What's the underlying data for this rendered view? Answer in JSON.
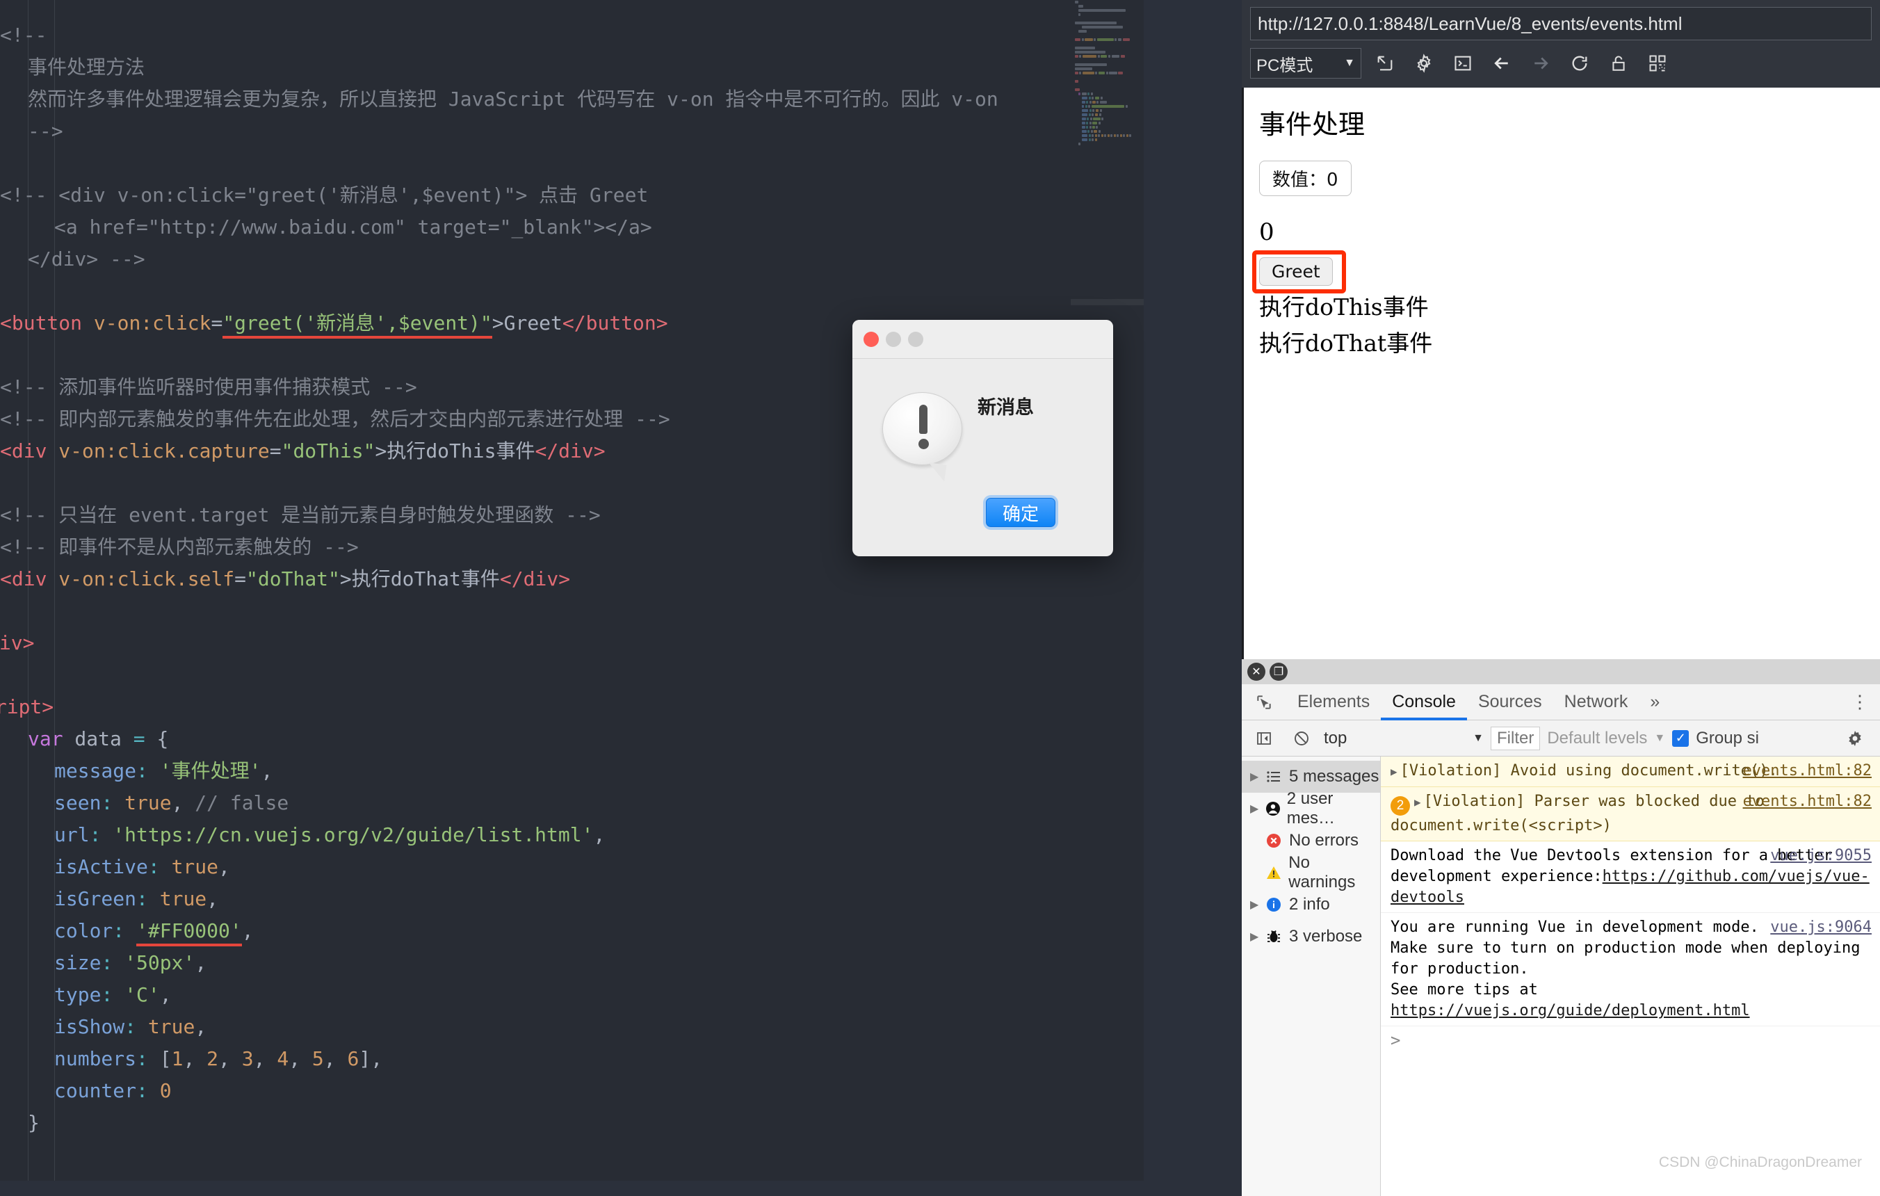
{
  "editor": {
    "lines": [
      {
        "indent": 0,
        "parts": [
          {
            "t": "<!--",
            "c": "cmt"
          }
        ]
      },
      {
        "indent": 1,
        "parts": [
          {
            "t": "事件处理方法",
            "c": "cmt"
          }
        ]
      },
      {
        "indent": 1,
        "parts": [
          {
            "t": "然而许多事件处理逻辑会更为复杂，所以直接把 JavaScript 代码写在 v-on 指令中是不可行的。因此 v-on",
            "c": "cmt"
          }
        ]
      },
      {
        "indent": 1,
        "parts": [
          {
            "t": "-->",
            "c": "cmt"
          }
        ]
      },
      {
        "indent": 0,
        "parts": []
      },
      {
        "indent": 0,
        "parts": [
          {
            "t": "<!-- <div v-on:click=\"greet('新消息',$event)\"> 点击 Greet",
            "c": "cmt"
          }
        ]
      },
      {
        "indent": 2,
        "parts": [
          {
            "t": "<a href=\"http://www.baidu.com\" target=\"_blank\"></a>",
            "c": "cmt"
          }
        ]
      },
      {
        "indent": 1,
        "parts": [
          {
            "t": "</div> -->",
            "c": "cmt"
          }
        ]
      },
      {
        "indent": 0,
        "parts": []
      },
      {
        "indent": 0,
        "parts": [
          {
            "t": "<button",
            "c": "tag"
          },
          {
            "t": " ",
            "c": "plain"
          },
          {
            "t": "v-on:click",
            "c": "attr"
          },
          {
            "t": "=",
            "c": "plain"
          },
          {
            "t": "\"greet('新消息',$event)\"",
            "c": "str",
            "underline": true
          },
          {
            "t": ">",
            "c": "plain"
          },
          {
            "t": "Greet",
            "c": "txt"
          },
          {
            "t": "</button>",
            "c": "tag"
          }
        ]
      },
      {
        "indent": 0,
        "parts": []
      },
      {
        "indent": 0,
        "parts": [
          {
            "t": "<!-- 添加事件监听器时使用事件捕获模式 -->",
            "c": "cmt"
          }
        ]
      },
      {
        "indent": 0,
        "parts": [
          {
            "t": "<!-- 即内部元素触发的事件先在此处理，然后才交由内部元素进行处理 -->",
            "c": "cmt"
          }
        ]
      },
      {
        "indent": 0,
        "parts": [
          {
            "t": "<div",
            "c": "tag"
          },
          {
            "t": " ",
            "c": "plain"
          },
          {
            "t": "v-on:click.capture",
            "c": "attr"
          },
          {
            "t": "=",
            "c": "plain"
          },
          {
            "t": "\"doThis\"",
            "c": "str"
          },
          {
            "t": ">",
            "c": "plain"
          },
          {
            "t": "执行doThis事件",
            "c": "txt"
          },
          {
            "t": "</div>",
            "c": "tag"
          }
        ]
      },
      {
        "indent": 0,
        "parts": []
      },
      {
        "indent": 0,
        "parts": [
          {
            "t": "<!-- 只当在 event.target 是当前元素自身时触发处理函数 -->",
            "c": "cmt"
          }
        ]
      },
      {
        "indent": 0,
        "parts": [
          {
            "t": "<!-- 即事件不是从内部元素触发的 -->",
            "c": "cmt"
          }
        ]
      },
      {
        "indent": 0,
        "parts": [
          {
            "t": "<div",
            "c": "tag"
          },
          {
            "t": " ",
            "c": "plain"
          },
          {
            "t": "v-on:click.self",
            "c": "attr"
          },
          {
            "t": "=",
            "c": "plain"
          },
          {
            "t": "\"doThat\"",
            "c": "str"
          },
          {
            "t": ">",
            "c": "plain"
          },
          {
            "t": "执行doThat事件",
            "c": "txt"
          },
          {
            "t": "</div>",
            "c": "tag"
          }
        ]
      },
      {
        "indent": 0,
        "parts": []
      },
      {
        "indent": 0,
        "parts": [
          {
            "t": "div>",
            "c": "tag",
            "offset": -18
          }
        ]
      },
      {
        "indent": 0,
        "parts": []
      },
      {
        "indent": 0,
        "parts": [
          {
            "t": "cript>",
            "c": "tag",
            "offset": -24
          }
        ]
      },
      {
        "indent": 1,
        "parts": [
          {
            "t": "var",
            "c": "kw"
          },
          {
            "t": " data ",
            "c": "plain"
          },
          {
            "t": "=",
            "c": "punc"
          },
          {
            "t": " {",
            "c": "plain"
          }
        ]
      },
      {
        "indent": 2,
        "parts": [
          {
            "t": "message",
            "c": "prop"
          },
          {
            "t": ":",
            "c": "punc"
          },
          {
            "t": " ",
            "c": "plain"
          },
          {
            "t": "'事件处理'",
            "c": "str"
          },
          {
            "t": ",",
            "c": "plain"
          }
        ]
      },
      {
        "indent": 2,
        "parts": [
          {
            "t": "seen",
            "c": "prop"
          },
          {
            "t": ":",
            "c": "punc"
          },
          {
            "t": " ",
            "c": "plain"
          },
          {
            "t": "true",
            "c": "attr"
          },
          {
            "t": ",",
            "c": "plain"
          },
          {
            "t": " // false",
            "c": "cmt"
          }
        ]
      },
      {
        "indent": 2,
        "parts": [
          {
            "t": "url",
            "c": "prop"
          },
          {
            "t": ":",
            "c": "punc"
          },
          {
            "t": " ",
            "c": "plain"
          },
          {
            "t": "'https://cn.vuejs.org/v2/guide/list.html'",
            "c": "str"
          },
          {
            "t": ",",
            "c": "plain"
          }
        ]
      },
      {
        "indent": 2,
        "parts": [
          {
            "t": "isActive",
            "c": "prop"
          },
          {
            "t": ":",
            "c": "punc"
          },
          {
            "t": " ",
            "c": "plain"
          },
          {
            "t": "true",
            "c": "attr"
          },
          {
            "t": ",",
            "c": "plain"
          }
        ]
      },
      {
        "indent": 2,
        "parts": [
          {
            "t": "isGreen",
            "c": "prop"
          },
          {
            "t": ":",
            "c": "punc"
          },
          {
            "t": " ",
            "c": "plain"
          },
          {
            "t": "true",
            "c": "attr"
          },
          {
            "t": ",",
            "c": "plain"
          }
        ]
      },
      {
        "indent": 2,
        "parts": [
          {
            "t": "color",
            "c": "prop"
          },
          {
            "t": ":",
            "c": "punc"
          },
          {
            "t": " ",
            "c": "plain"
          },
          {
            "t": "'#FF0000'",
            "c": "str",
            "underline": true
          },
          {
            "t": ",",
            "c": "plain"
          }
        ]
      },
      {
        "indent": 2,
        "parts": [
          {
            "t": "size",
            "c": "prop"
          },
          {
            "t": ":",
            "c": "punc"
          },
          {
            "t": " ",
            "c": "plain"
          },
          {
            "t": "'50px'",
            "c": "str"
          },
          {
            "t": ",",
            "c": "plain"
          }
        ]
      },
      {
        "indent": 2,
        "parts": [
          {
            "t": "type",
            "c": "prop"
          },
          {
            "t": ":",
            "c": "punc"
          },
          {
            "t": " ",
            "c": "plain"
          },
          {
            "t": "'C'",
            "c": "str"
          },
          {
            "t": ",",
            "c": "plain"
          }
        ]
      },
      {
        "indent": 2,
        "parts": [
          {
            "t": "isShow",
            "c": "prop"
          },
          {
            "t": ":",
            "c": "punc"
          },
          {
            "t": " ",
            "c": "plain"
          },
          {
            "t": "true",
            "c": "attr"
          },
          {
            "t": ",",
            "c": "plain"
          }
        ]
      },
      {
        "indent": 2,
        "parts": [
          {
            "t": "numbers",
            "c": "prop"
          },
          {
            "t": ":",
            "c": "punc"
          },
          {
            "t": " [",
            "c": "plain"
          },
          {
            "t": "1",
            "c": "num"
          },
          {
            "t": ", ",
            "c": "plain"
          },
          {
            "t": "2",
            "c": "num"
          },
          {
            "t": ", ",
            "c": "plain"
          },
          {
            "t": "3",
            "c": "num"
          },
          {
            "t": ", ",
            "c": "plain"
          },
          {
            "t": "4",
            "c": "num"
          },
          {
            "t": ", ",
            "c": "plain"
          },
          {
            "t": "5",
            "c": "num"
          },
          {
            "t": ", ",
            "c": "plain"
          },
          {
            "t": "6",
            "c": "num"
          },
          {
            "t": "],",
            "c": "plain"
          }
        ]
      },
      {
        "indent": 2,
        "parts": [
          {
            "t": "counter",
            "c": "prop"
          },
          {
            "t": ":",
            "c": "punc"
          },
          {
            "t": " ",
            "c": "plain"
          },
          {
            "t": "0",
            "c": "num"
          }
        ]
      },
      {
        "indent": 1,
        "parts": [
          {
            "t": "}",
            "c": "plain"
          }
        ]
      }
    ]
  },
  "alert": {
    "title": "新消息",
    "ok_label": "确定",
    "icon_name": "exclamation-speech-bubble"
  },
  "browser": {
    "url": "http://127.0.0.1:8848/LearnVue/8_events/events.html",
    "mode": "PC模式",
    "mode_caret": "▼",
    "icons": [
      "open-external-icon",
      "gear-icon",
      "terminal-icon",
      "back-arrow-icon",
      "forward-arrow-icon",
      "reload-icon",
      "lock-icon",
      "qr-code-icon"
    ]
  },
  "page": {
    "heading": "事件处理",
    "counter_pill": "数值：0",
    "counter_value": "0",
    "greet_button": "Greet",
    "do_this_line": "执行doThis事件",
    "do_that_line": "执行doThat事件"
  },
  "devtools": {
    "tabs": [
      {
        "label": "Elements",
        "active": false
      },
      {
        "label": "Console",
        "active": true
      },
      {
        "label": "Sources",
        "active": false
      },
      {
        "label": "Network",
        "active": false
      },
      {
        "label": "»",
        "active": false
      }
    ],
    "filter": {
      "context": "top",
      "caret": "▼",
      "filter_label": "Filter",
      "levels_label": "Default levels",
      "levels_caret": "▼",
      "group_label": "Group si",
      "checkbox_glyph": "✓"
    },
    "sidebar": [
      {
        "label": "5 messages",
        "icon": "list-icon",
        "expandable": true,
        "selected": true
      },
      {
        "label": "2 user mes…",
        "icon": "user-icon",
        "expandable": true,
        "selected": false
      },
      {
        "label": "No errors",
        "icon": "error-icon",
        "expandable": false,
        "selected": false
      },
      {
        "label": "No warnings",
        "icon": "warning-icon",
        "expandable": false,
        "selected": false
      },
      {
        "label": "2 info",
        "icon": "info-icon",
        "expandable": true,
        "selected": false
      },
      {
        "label": "3 verbose",
        "icon": "bug-icon",
        "expandable": true,
        "selected": false
      }
    ],
    "messages": [
      {
        "badge": null,
        "text": "[Violation] Avoid using document.write().",
        "source": "events.html:82",
        "level": "warning",
        "expandable": true
      },
      {
        "badge": "2",
        "text": "[Violation] Parser was blocked due to document.write(<script>)",
        "source": "events.html:82",
        "level": "warning",
        "expandable": true
      },
      {
        "badge": null,
        "text": "Download the Vue Devtools extension for a better development experience:",
        "link": "https://github.com/vuejs/vue-devtools",
        "source": "vue.js:9055",
        "level": "info",
        "expandable": false
      },
      {
        "badge": null,
        "text": "You are running Vue in development mode.\nMake sure to turn on production mode when deploying for production.\nSee more tips at ",
        "link": "https://vuejs.org/guide/deployment.html",
        "source": "vue.js:9064",
        "level": "info",
        "expandable": false
      }
    ],
    "prompt": ">"
  },
  "watermark": "CSDN @ChinaDragonDreamer",
  "colors": {
    "editor_bg": "#282c34",
    "accent_red": "#fc2d04",
    "devtools_accent": "#1a73e8",
    "warn_bg": "#fffbe5"
  }
}
